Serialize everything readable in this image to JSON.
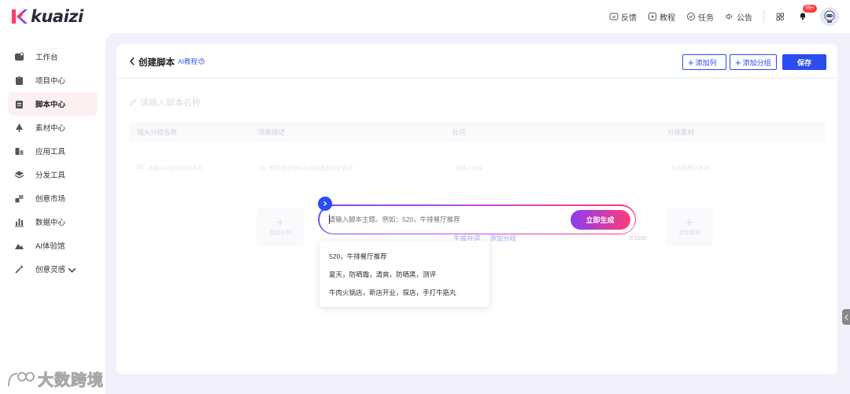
{
  "brand": {
    "name": "kuaizi"
  },
  "topnav": {
    "feedback": "反馈",
    "tutorial": "教程",
    "tasks": "任务",
    "notice": "公告",
    "badge": "99+"
  },
  "sidebar": {
    "items": [
      {
        "label": "工作台"
      },
      {
        "label": "项目中心"
      },
      {
        "label": "脚本中心"
      },
      {
        "label": "素材中心"
      },
      {
        "label": "应用工具"
      },
      {
        "label": "分发工具"
      },
      {
        "label": "创意市场"
      },
      {
        "label": "数据中心"
      },
      {
        "label": "AI体验馆"
      },
      {
        "label": "创意灵感"
      }
    ]
  },
  "header": {
    "title": "创建脚本",
    "ai_tutorial": "AI教程",
    "add_column": "添加列",
    "add_group": "添加分组",
    "save": "保存"
  },
  "script_name_placeholder": "请输入脚本名称",
  "table": {
    "columns": [
      "镜头分组名称",
      "场景描述",
      "台词",
      "分镜素材"
    ],
    "row_index": "01",
    "row_group_placeholder": "请输入分组名称如开头",
    "row_scene_placeholder": "如: \"模特面对镜头从包装盒取出护肤品\"",
    "row_line_placeholder": "请输入台词",
    "row_material_placeholder": "支持拖拽队多选",
    "add_example": "添加示例",
    "add_material": "添加素材",
    "generate_lines": "生成台词",
    "add_segment": "添加分段",
    "char_count": "0/1500"
  },
  "prompt": {
    "placeholder": "请输入脚本主题。例如：520，牛排餐厅推荐",
    "generate_button": "立即生成"
  },
  "suggestions": [
    "520，牛排餐厅推荐",
    "夏天，防晒霜，清爽，防晒黑，测评",
    "牛肉火锅店，新店开业，探店，手打牛筋丸"
  ],
  "watermark": "大数跨境",
  "colors": {
    "primary": "#2a4cf0",
    "active_bg": "#fdf0f2",
    "page_bg": "#f1f0fb",
    "gradient_start": "#8a3df0",
    "gradient_end": "#ff3b7a"
  }
}
